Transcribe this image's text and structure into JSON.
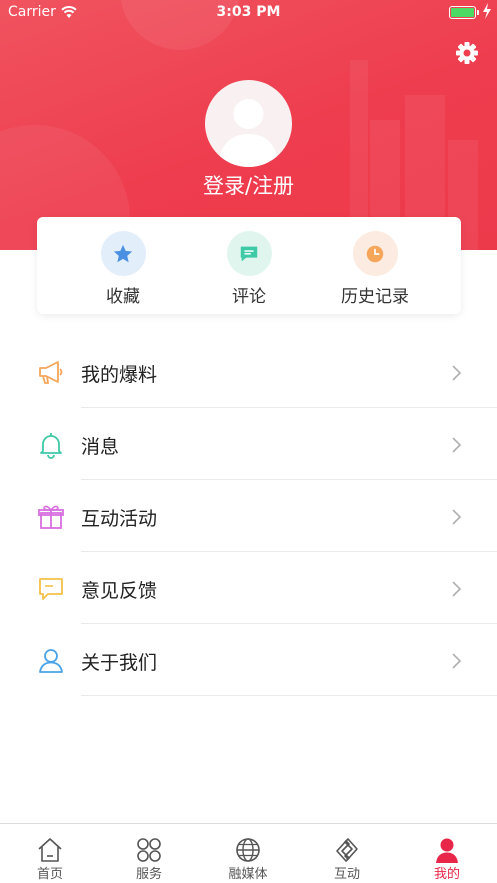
{
  "status_bar": {
    "carrier": "Carrier",
    "time": "3:03 PM"
  },
  "profile": {
    "login_label": "登录/注册"
  },
  "quick_actions": [
    {
      "label": "收藏",
      "icon": "star-icon",
      "color": "#4a90e2"
    },
    {
      "label": "评论",
      "icon": "comment-icon",
      "color": "#3ec9a7"
    },
    {
      "label": "历史记录",
      "icon": "clock-icon",
      "color": "#f5a65b"
    }
  ],
  "menu": [
    {
      "label": "我的爆料",
      "icon": "megaphone-icon",
      "color": "#f5a65b"
    },
    {
      "label": "消息",
      "icon": "bell-icon",
      "color": "#3ec9a7"
    },
    {
      "label": "互动活动",
      "icon": "gift-icon",
      "color": "#d86fe0"
    },
    {
      "label": "意见反馈",
      "icon": "feedback-icon",
      "color": "#f5c04a"
    },
    {
      "label": "关于我们",
      "icon": "user-icon",
      "color": "#4aa3e8"
    }
  ],
  "tabbar": [
    {
      "label": "首页",
      "icon": "home-icon"
    },
    {
      "label": "服务",
      "icon": "grid-icon"
    },
    {
      "label": "融媒体",
      "icon": "globe-icon"
    },
    {
      "label": "互动",
      "icon": "interact-icon"
    },
    {
      "label": "我的",
      "icon": "profile-icon",
      "active": true
    }
  ],
  "colors": {
    "header_red": "#ef3f50",
    "active_tab": "#e8264a"
  }
}
